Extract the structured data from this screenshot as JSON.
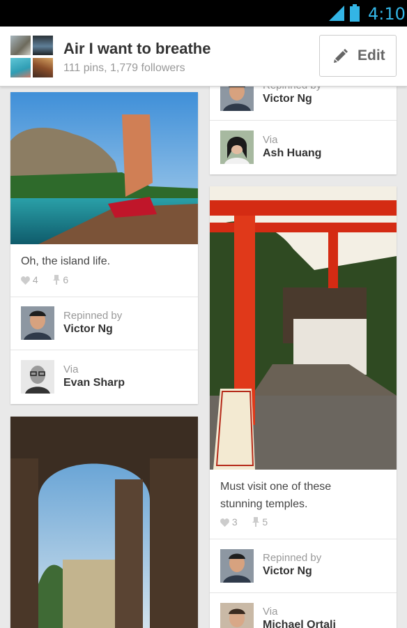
{
  "status_bar": {
    "time": "4:10",
    "icons": [
      "signal-icon",
      "battery-icon"
    ],
    "accent": "#33b5e5"
  },
  "board": {
    "title": "Air I want to breathe",
    "meta": "111 pins, 1,779 followers",
    "edit_label": "Edit",
    "edit_icon": "pencil-icon"
  },
  "pins": {
    "top_partial": {
      "repinned_label": "Repinned by",
      "repinned_name": "Victor Ng",
      "via_label": "Via",
      "via_name": "Ash Huang"
    },
    "island": {
      "description": "Oh, the island life.",
      "likes": "4",
      "repins": "6",
      "repinned_label": "Repinned by",
      "repinned_name": "Victor Ng",
      "via_label": "Via",
      "via_name": "Evan Sharp"
    },
    "temple": {
      "description_line1": "Must visit one of these",
      "description_line2": "stunning temples.",
      "likes": "3",
      "repins": "5",
      "repinned_label": "Repinned by",
      "repinned_name": "Victor Ng",
      "via_label": "Via",
      "via_name": "Michael Ortali"
    }
  }
}
